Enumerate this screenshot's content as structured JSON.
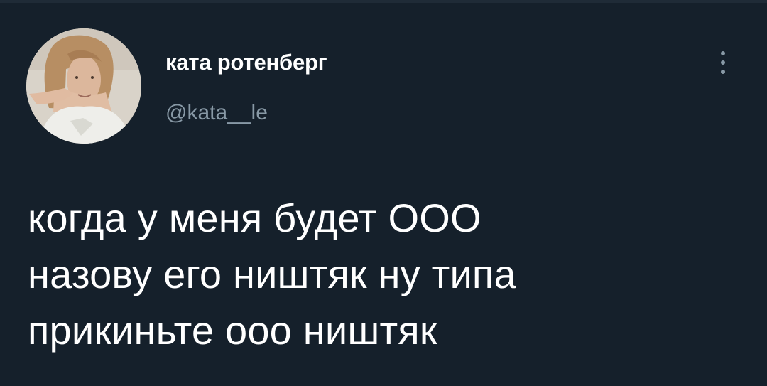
{
  "tweet": {
    "author": {
      "display_name": "ката ротенберг",
      "handle": "@kata__le",
      "avatar": "profile-photo"
    },
    "more_icon": "more-vertical-icon",
    "text_lines": [
      "когда у меня будет ООО",
      "назову его ништяк ну типа",
      "прикиньте ооо ништяк"
    ]
  },
  "colors": {
    "background": "#15202b",
    "text": "#ffffff",
    "secondary_text": "#8899a6"
  }
}
